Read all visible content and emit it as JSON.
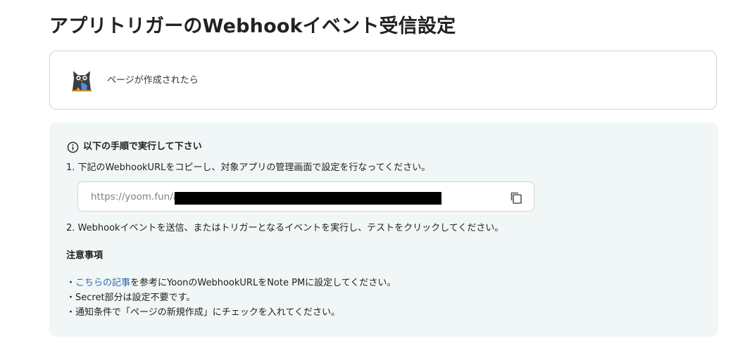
{
  "page": {
    "title": "アプリトリガーのWebhookイベント受信設定"
  },
  "trigger": {
    "label": "ページが作成されたら",
    "app_icon": "owl-app-logo"
  },
  "instructions": {
    "heading": "以下の手順で実行して下さい",
    "step1": "1. 下記のWebhookURLをコピーし、対象アプリの管理画面で設定を行なってください。",
    "url_visible": "https://yoom.fun/a",
    "step2": "2. Webhookイベントを送信、またはトリガーとなるイベントを実行し、テストをクリックしてください。",
    "icons": {
      "info": "info-icon",
      "copy": "copy-icon"
    }
  },
  "notes": {
    "heading": "注意事項",
    "note1_prefix": "・",
    "note1_link": "こちらの記事",
    "note1_rest": "を参考にYoonのWebhookURLをNote PMに設定してください。",
    "note2": "・Secret部分は設定不要です。",
    "note3": "・通知条件で「ページの新規作成」にチェックを入れてください。"
  },
  "colors": {
    "panel_bg": "#f1f6f6",
    "border": "#cfd4d8",
    "link": "#2b6cb0",
    "url_text": "#7b8187"
  }
}
